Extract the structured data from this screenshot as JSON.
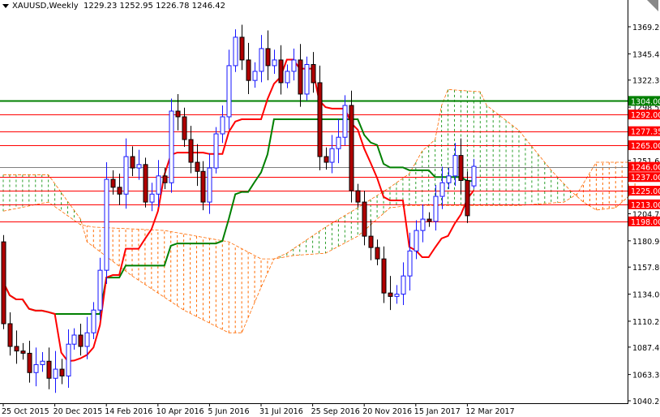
{
  "header": {
    "symbol": "XAUUSD,Weekly",
    "ohlc": "1229.23 1252.95 1226.78 1246.42"
  },
  "colors": {
    "bull": "#1515ff",
    "bear": "#e00000",
    "bear_body": "#b00000",
    "tenkan": "#ff0000",
    "kijun": "#008000",
    "cloud_bear": "#ff6a00",
    "cloud_bull": "#2ca02c",
    "level_red": "#ff0000",
    "level_green": "#008000",
    "level_grey": "#808080"
  },
  "chart_data": {
    "type": "candlestick",
    "title": "XAUUSD,Weekly",
    "ylim": [
      1040.2,
      1369.2
    ],
    "y_ticks": [
      "1369.20",
      "1345.40",
      "1322.30",
      "1298.50",
      "1251.60",
      "1204.70",
      "1180.90",
      "1157.80",
      "1134.00",
      "1110.20",
      "1087.40",
      "1063.30",
      "1040.20"
    ],
    "x_tick_labels": [
      {
        "index": 0,
        "label": "25 Oct 2015"
      },
      {
        "index": 8,
        "label": "20 Dec 2015"
      },
      {
        "index": 16,
        "label": "14 Feb 2016"
      },
      {
        "index": 24,
        "label": "10 Apr 2016"
      },
      {
        "index": 32,
        "label": "5 Jun 2016"
      },
      {
        "index": 40,
        "label": "31 Jul 2016"
      },
      {
        "index": 48,
        "label": "25 Sep 2016"
      },
      {
        "index": 56,
        "label": "20 Nov 2016"
      },
      {
        "index": 64,
        "label": "15 Jan 2017"
      },
      {
        "index": 72,
        "label": "12 Mar 2017"
      }
    ],
    "first_open": 1180,
    "closes": [
      1108,
      1088,
      1084,
      1082,
      1065,
      1072,
      1075,
      1060,
      1068,
      1062,
      1090,
      1098,
      1088,
      1100,
      1120,
      1155,
      1235,
      1228,
      1222,
      1255,
      1245,
      1248,
      1215,
      1222,
      1238,
      1232,
      1295,
      1290,
      1270,
      1250,
      1242,
      1215,
      1245,
      1275,
      1290,
      1335,
      1360,
      1340,
      1322,
      1330,
      1350,
      1335,
      1340,
      1320,
      1330,
      1340,
      1310,
      1336,
      1320,
      1255,
      1250,
      1262,
      1272,
      1300,
      1225,
      1215,
      1185,
      1175,
      1165,
      1135,
      1132,
      1134,
      1150,
      1172,
      1190,
      1200,
      1198,
      1220,
      1232,
      1238,
      1256,
      1234,
      1203,
      1246.42
    ],
    "last_candle": {
      "open": 1229.23,
      "high": 1252.95,
      "low": 1226.78,
      "close": 1246.42
    },
    "senkou_a": [
      [
        0,
        1239
      ],
      [
        7,
        1239
      ],
      [
        12,
        1200
      ],
      [
        13,
        1180
      ],
      [
        20,
        1150
      ],
      [
        28,
        1120
      ],
      [
        35,
        1100
      ],
      [
        37,
        1100
      ],
      [
        40,
        1140
      ],
      [
        42,
        1165
      ],
      [
        44,
        1170
      ],
      [
        50,
        1193
      ],
      [
        55,
        1210
      ],
      [
        60,
        1228
      ],
      [
        63,
        1240
      ],
      [
        65,
        1260
      ],
      [
        67,
        1270
      ],
      [
        68,
        1300
      ],
      [
        69,
        1314
      ],
      [
        74,
        1312
      ],
      [
        75,
        1300
      ],
      [
        80,
        1278
      ],
      [
        85,
        1243
      ],
      [
        88,
        1225
      ],
      [
        90,
        1215
      ],
      [
        92,
        1208
      ],
      [
        95,
        1210
      ],
      [
        98,
        1225
      ]
    ],
    "senkou_b": [
      [
        0,
        1207
      ],
      [
        7,
        1215
      ],
      [
        12,
        1195
      ],
      [
        14,
        1193
      ],
      [
        25,
        1190
      ],
      [
        30,
        1185
      ],
      [
        35,
        1180
      ],
      [
        40,
        1165
      ],
      [
        42,
        1165
      ],
      [
        45,
        1168
      ],
      [
        50,
        1170
      ],
      [
        55,
        1185
      ],
      [
        60,
        1210
      ],
      [
        63,
        1212
      ],
      [
        70,
        1212
      ],
      [
        80,
        1212
      ],
      [
        87,
        1215
      ],
      [
        89,
        1222
      ],
      [
        92,
        1250
      ],
      [
        98,
        1250
      ]
    ],
    "levels": [
      {
        "value": 1304.0,
        "label": "1304.00",
        "color": "green"
      },
      {
        "value": 1292.0,
        "label": "1292.00",
        "color": "red"
      },
      {
        "value": 1277.35,
        "label": "1277.35",
        "color": "red"
      },
      {
        "value": 1265.0,
        "label": "1265.00",
        "color": "red"
      },
      {
        "value": 1246.0,
        "label": "1246.00",
        "color": "grey"
      },
      {
        "value": 1237.0,
        "label": "1237.00",
        "color": "red"
      },
      {
        "value": 1225.0,
        "label": "1225.00",
        "color": "red"
      },
      {
        "value": 1213.0,
        "label": "1213.00",
        "color": "red"
      },
      {
        "value": 1198.0,
        "label": "1198.00",
        "color": "red"
      }
    ]
  }
}
